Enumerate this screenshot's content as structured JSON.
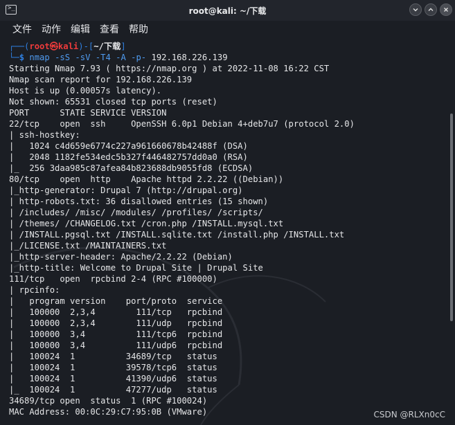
{
  "window": {
    "title": "root@kali: ~/下载"
  },
  "menu": [
    "文件",
    "动作",
    "编辑",
    "查看",
    "帮助"
  ],
  "prompt": {
    "frame_top_left": "┌──(",
    "user": "root㉿kali",
    "frame_mid": ")-[",
    "dir": "~/下载",
    "frame_end": "]",
    "frame_bottom": "└─",
    "symbol": "$",
    "command": "nmap",
    "args_colored": " -sS -sV -T4 -A -p-",
    "target": " 192.168.226.139"
  },
  "output": [
    "Starting Nmap 7.93 ( https://nmap.org ) at 2022-11-08 16:22 CST",
    "Nmap scan report for 192.168.226.139",
    "Host is up (0.00057s latency).",
    "Not shown: 65531 closed tcp ports (reset)",
    "PORT      STATE SERVICE VERSION",
    "22/tcp    open  ssh     OpenSSH 6.0p1 Debian 4+deb7u7 (protocol 2.0)",
    "| ssh-hostkey:",
    "|   1024 c4d659e6774c227a961660678b42488f (DSA)",
    "|   2048 1182fe534edc5b327f446482757dd0a0 (RSA)",
    "|_  256 3daa985c87afea84b823688db9055fd8 (ECDSA)",
    "80/tcp    open  http    Apache httpd 2.2.22 ((Debian))",
    "|_http-generator: Drupal 7 (http://drupal.org)",
    "| http-robots.txt: 36 disallowed entries (15 shown)",
    "| /includes/ /misc/ /modules/ /profiles/ /scripts/",
    "| /themes/ /CHANGELOG.txt /cron.php /INSTALL.mysql.txt",
    "| /INSTALL.pgsql.txt /INSTALL.sqlite.txt /install.php /INSTALL.txt",
    "|_/LICENSE.txt /MAINTAINERS.txt",
    "|_http-server-header: Apache/2.2.22 (Debian)",
    "|_http-title: Welcome to Drupal Site | Drupal Site",
    "111/tcp   open  rpcbind 2-4 (RPC #100000)",
    "| rpcinfo:",
    "|   program version    port/proto  service",
    "|   100000  2,3,4        111/tcp   rpcbind",
    "|   100000  2,3,4        111/udp   rpcbind",
    "|   100000  3,4          111/tcp6  rpcbind",
    "|   100000  3,4          111/udp6  rpcbind",
    "|   100024  1          34689/tcp   status",
    "|   100024  1          39578/tcp6  status",
    "|   100024  1          41390/udp6  status",
    "|_  100024  1          47277/udp   status",
    "34689/tcp open  status  1 (RPC #100024)",
    "MAC Address: 00:0C:29:C7:95:0B (VMware)"
  ],
  "watermark": "CSDN @RLXn0cC"
}
